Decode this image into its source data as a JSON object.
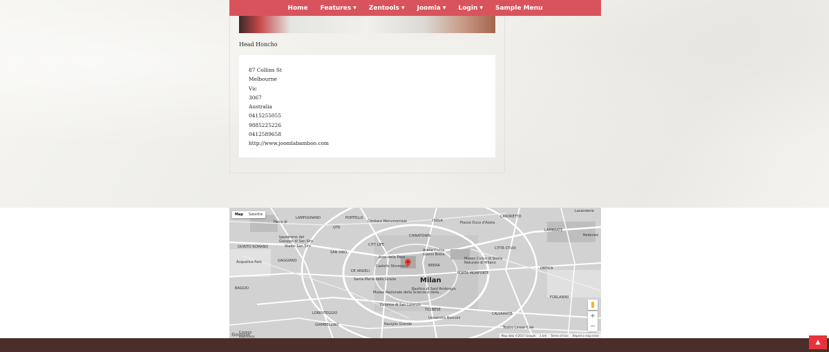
{
  "nav": {
    "items": [
      {
        "label": "Home",
        "has_dropdown": false
      },
      {
        "label": "Features",
        "has_dropdown": true
      },
      {
        "label": "Zentools",
        "has_dropdown": true
      },
      {
        "label": "Joomla",
        "has_dropdown": true
      },
      {
        "label": "Login",
        "has_dropdown": true
      },
      {
        "label": "Sample Menu",
        "has_dropdown": false
      }
    ],
    "caret": "▼"
  },
  "contact": {
    "role": "Head Honcho",
    "address_lines": [
      "87 Collins St",
      "Melbourne",
      "Vic",
      "3067",
      "Australia",
      "0415255055",
      "9885225226",
      "0412589658",
      "http://www.joomlabamboo.com"
    ]
  },
  "map": {
    "type_options": {
      "map": "Map",
      "satellite": "Satellite"
    },
    "city_label": "Milan",
    "labels": {
      "portello": "PORTELLO",
      "cimitero": "Cimitero Monumentale",
      "isola": "ISOLA",
      "piazza_aosta": "Piazza Duca d'Aosta",
      "casoretto": "CASORETTO",
      "lavanderie": "Lavanderie",
      "parco": "Parco di",
      "lampugnano": "LAMPUGNANO",
      "qt8": "QT8",
      "chinatown": "CHINATOWN",
      "citta_studi": "CITTÀ STUDI",
      "lambrate": "LAMBRATE",
      "ippodromo": "Ippodromo del",
      "galoppo": "Galoppo di San Siro",
      "stadio": "Stadio San Siro",
      "city_life": "CITY LIFE",
      "arena": "Arena Civica",
      "gianni_brera": "Gianni Brera",
      "redecesi": "Redecesi",
      "quinto_romano": "QUINTO ROMANO",
      "san_siro": "SAN SIRO",
      "arco_pace": "Arco della Pace",
      "museo_storia": "Museo Civico di Storia",
      "naturale": "Naturale di Milano",
      "aquatica": "Acquatica Park",
      "gaggiano": "GAGGIANO",
      "castello": "Castello Sforzesco",
      "brera": "BRERA",
      "ortica": "ORTICA",
      "de_angeli": "DE ANGELI",
      "porta_monforte": "PORTA MONFORTE",
      "santa_maria": "Santa Maria delle Grazie",
      "baggio": "BAGGIO",
      "museo_scienza": "Museo Nazionale della Scienza e della...",
      "basilica": "Basilica di Sant'Ambrogio",
      "forlanini": "FORLANINI",
      "colonne": "Colonne di San Lorenzo",
      "lorenteggio": "LORENTEGGIO",
      "ticinese": "TICINESE",
      "calvairate": "CALVAIRATE",
      "giambellino": "GIAMBELLINO",
      "naviglio": "Naviglio Grande",
      "universita": "Università Bocconi",
      "teatro": "Teatro Linear Ciak",
      "corsico": "Corsico",
      "buccinasco": "Buccinasco"
    },
    "google_logo": "Google",
    "attribution": {
      "map_data": "Map data ©2017 Google",
      "scale": "1 km",
      "terms": "Terms of Use",
      "report": "Report a map error"
    },
    "zoom_in": "+",
    "zoom_out": "−"
  },
  "footer": {
    "back_to_top_icon": "arrow-up-icon",
    "back_to_top_glyph": "▲"
  },
  "colors": {
    "nav_bg": "#d9535d",
    "footer_bg": "#4a2e29",
    "back_to_top": "#e8333c"
  }
}
